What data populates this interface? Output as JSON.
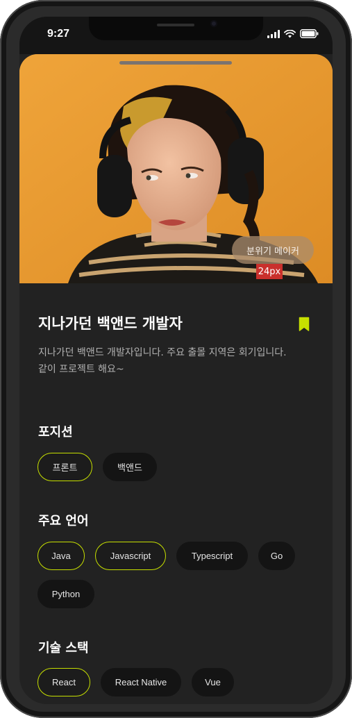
{
  "status_bar": {
    "time": "9:27"
  },
  "hero": {
    "photo_description_icon": "portrait-photo",
    "tooltip": "분위기 메이커",
    "spacing_label": "24px"
  },
  "profile": {
    "title": "지나가던 백앤드 개발자",
    "description": "지나가던 백앤드 개발자입니다. 주요 출몰 지역은 회기입니다. 같이 프로젝트 해요~",
    "bookmark_icon": "bookmark-icon"
  },
  "sections": {
    "position": {
      "title": "포지션",
      "chips": [
        {
          "label": "프론트",
          "selected": true
        },
        {
          "label": "백앤드",
          "selected": false
        }
      ]
    },
    "languages": {
      "title": "주요 언어",
      "chips": [
        {
          "label": "Java",
          "selected": true
        },
        {
          "label": "Javascript",
          "selected": true
        },
        {
          "label": "Typescript",
          "selected": false
        },
        {
          "label": "Go",
          "selected": false
        },
        {
          "label": "Python",
          "selected": false
        }
      ]
    },
    "stack": {
      "title": "기술 스택",
      "chips": [
        {
          "label": "React",
          "selected": true
        },
        {
          "label": "React Native",
          "selected": false
        },
        {
          "label": "Vue",
          "selected": false
        }
      ]
    }
  },
  "colors": {
    "accent": "#c7e000",
    "background": "#222222",
    "chip": "#141414",
    "hero": "#e89a2d"
  }
}
